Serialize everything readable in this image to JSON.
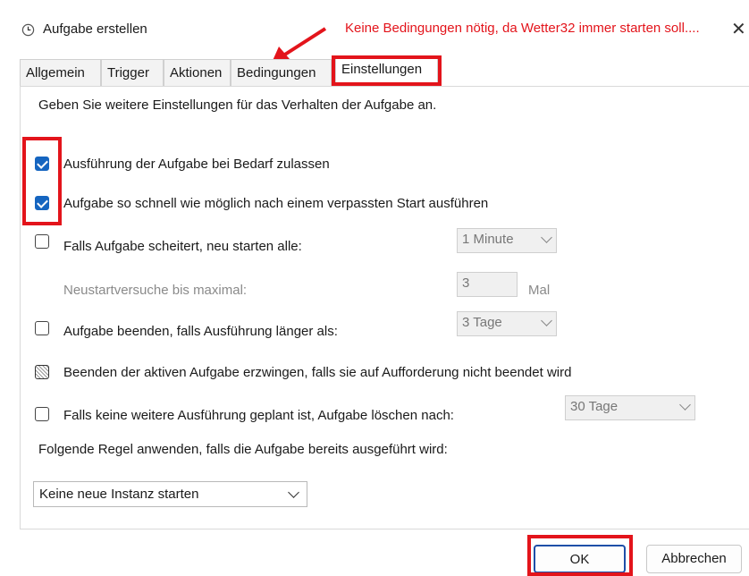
{
  "window": {
    "title": "Aufgabe erstellen",
    "annotation": "Keine Bedingungen nötig, da Wetter32 immer starten soll....",
    "close_glyph": "✕",
    "icon": "clock-icon"
  },
  "tabs": [
    {
      "label": "Allgemein"
    },
    {
      "label": "Trigger"
    },
    {
      "label": "Aktionen"
    },
    {
      "label": "Bedingungen"
    },
    {
      "label": "Einstellungen",
      "active": true
    }
  ],
  "settings": {
    "description": "Geben Sie weitere Einstellungen für das Verhalten der Aufgabe an.",
    "allow_on_demand": {
      "label": "Ausführung der Aufgabe bei Bedarf zulassen",
      "checked": true
    },
    "run_after_missed": {
      "label": "Aufgabe so schnell wie möglich nach einem verpassten Start ausführen",
      "checked": true
    },
    "restart_on_fail": {
      "label": "Falls Aufgabe scheitert, neu starten alle:",
      "checked": false,
      "value": "1 Minute"
    },
    "restart_attempts": {
      "label": "Neustartversuche bis maximal:",
      "value": "3",
      "unit": "Mal"
    },
    "stop_if_longer": {
      "label": "Aufgabe beenden, falls Ausführung länger als:",
      "checked": false,
      "value": "3 Tage"
    },
    "force_stop": {
      "label": "Beenden der aktiven Aufgabe erzwingen, falls sie auf Aufforderung nicht beendet wird",
      "state": "indeterminate"
    },
    "delete_after": {
      "label": "Falls keine weitere Ausführung geplant ist, Aufgabe löschen nach:",
      "checked": false,
      "value": "30 Tage"
    },
    "rule_label": "Folgende Regel anwenden, falls die Aufgabe bereits ausgeführt wird:",
    "rule_value": "Keine neue Instanz starten"
  },
  "buttons": {
    "ok": "OK",
    "cancel": "Abbrechen"
  },
  "colors": {
    "annotation_red": "#e3141b",
    "checkbox_blue": "#1565c0"
  }
}
